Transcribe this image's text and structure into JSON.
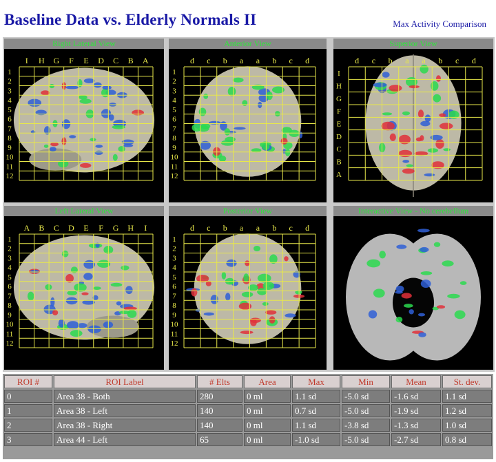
{
  "header": {
    "title": "Baseline Data vs. Elderly Normals II",
    "subtitle": "Max Activity Comparison"
  },
  "panels": [
    {
      "title": "Right Lateral View",
      "top_labels": [
        "I",
        "H",
        "G",
        "F",
        "E",
        "D",
        "C",
        "B",
        "A"
      ],
      "side_labels": [
        "1",
        "2",
        "3",
        "4",
        "5",
        "6",
        "7",
        "8",
        "9",
        "10",
        "11",
        "12"
      ]
    },
    {
      "title": "Anterior View",
      "top_labels": [
        "d",
        "c",
        "b",
        "a",
        "a",
        "b",
        "c",
        "d"
      ],
      "side_labels": [
        "1",
        "2",
        "3",
        "4",
        "5",
        "6",
        "7",
        "8",
        "9",
        "10",
        "11",
        "12"
      ]
    },
    {
      "title": "Superior View",
      "top_labels": [
        "d",
        "c",
        "b",
        "a",
        "a",
        "b",
        "c",
        "d"
      ],
      "side_labels": [
        "I",
        "H",
        "G",
        "F",
        "E",
        "D",
        "C",
        "B",
        "A"
      ]
    },
    {
      "title": "Left Lateral View",
      "top_labels": [
        "A",
        "B",
        "C",
        "D",
        "E",
        "F",
        "G",
        "H",
        "I"
      ],
      "side_labels": [
        "1",
        "2",
        "3",
        "4",
        "5",
        "6",
        "7",
        "8",
        "9",
        "10",
        "11",
        "12"
      ]
    },
    {
      "title": "Posterior View",
      "top_labels": [
        "d",
        "c",
        "b",
        "a",
        "a",
        "b",
        "c",
        "d"
      ],
      "side_labels": [
        "1",
        "2",
        "3",
        "4",
        "5",
        "6",
        "7",
        "8",
        "9",
        "10",
        "11",
        "12"
      ]
    },
    {
      "title": "Interactive View - No cerebellum"
    }
  ],
  "table": {
    "headers": [
      "ROI #",
      "ROI Label",
      "# Elts",
      "Area",
      "Max",
      "Min",
      "Mean",
      "St. dev."
    ],
    "rows": [
      [
        "0",
        "Area 38 - Both",
        "280",
        "0 ml",
        "1.1 sd",
        "-5.0 sd",
        "-1.6 sd",
        "1.1 sd"
      ],
      [
        "1",
        "Area 38 - Left",
        "140",
        "0 ml",
        "0.7 sd",
        "-5.0 sd",
        "-1.9 sd",
        "1.2 sd"
      ],
      [
        "2",
        "Area 38 - Right",
        "140",
        "0 ml",
        "1.1 sd",
        "-3.8 sd",
        "-1.3 sd",
        "1.0 sd"
      ],
      [
        "3",
        "Area 44 - Left",
        "65",
        "0 ml",
        "-1.0 sd",
        "-5.0 sd",
        "-2.7 sd",
        "0.8 sd"
      ]
    ]
  },
  "colors": {
    "title": "#1a1aa6",
    "panel_title_text": "#2ee83a",
    "grid": "#e8e84a",
    "brain": "#bdb9a6",
    "activity_green": "#2bd94f",
    "activity_blue": "#2f5fd6",
    "activity_red": "#e0303a",
    "table_header_text": "#c0392b"
  }
}
